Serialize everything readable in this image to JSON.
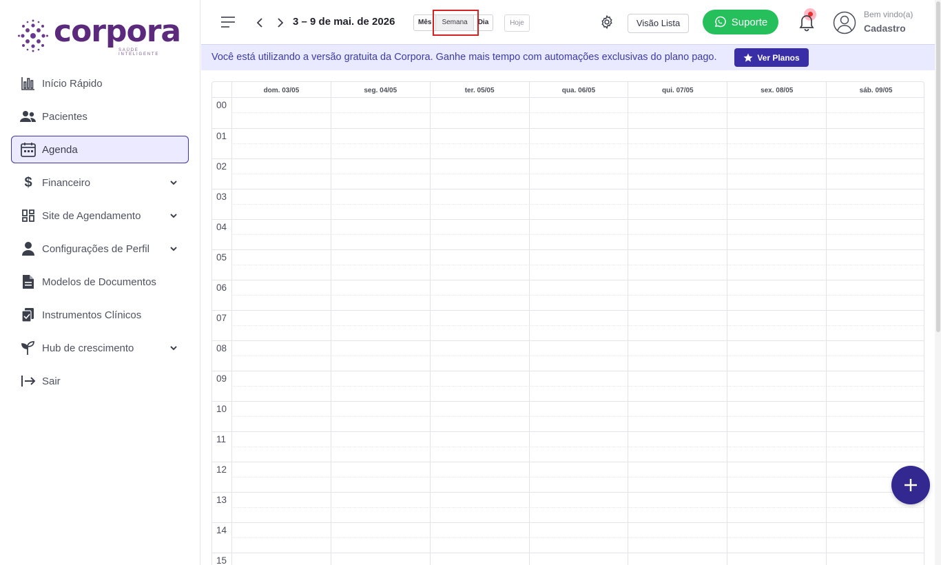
{
  "brand": {
    "name": "corpora",
    "tagline": "SAÚDE INTELIGENTE",
    "color": "#5b2a7d"
  },
  "sidebar": {
    "items": [
      {
        "label": "Início Rápido",
        "icon": "bar-chart-icon",
        "active": false,
        "expandable": false
      },
      {
        "label": "Pacientes",
        "icon": "users-icon",
        "active": false,
        "expandable": false
      },
      {
        "label": "Agenda",
        "icon": "calendar-icon",
        "active": true,
        "expandable": false
      },
      {
        "label": "Financeiro",
        "icon": "dollar-icon",
        "active": false,
        "expandable": true
      },
      {
        "label": "Site de Agendamento",
        "icon": "grid-icon",
        "active": false,
        "expandable": true
      },
      {
        "label": "Configurações de Perfil",
        "icon": "person-icon",
        "active": false,
        "expandable": true
      },
      {
        "label": "Modelos de Documentos",
        "icon": "document-icon",
        "active": false,
        "expandable": false
      },
      {
        "label": "Instrumentos Clínicos",
        "icon": "clipboard-icon",
        "active": false,
        "expandable": false
      },
      {
        "label": "Hub de crescimento",
        "icon": "sprout-icon",
        "active": false,
        "expandable": true
      },
      {
        "label": "Sair",
        "icon": "logout-icon",
        "active": false,
        "expandable": false
      }
    ]
  },
  "topbar": {
    "range_title": "3 – 9 de mai. de 2026",
    "views": {
      "month": "Mês",
      "week": "Semana",
      "day": "Dia"
    },
    "selected_view": "Semana",
    "today": "Hoje",
    "list_view": "Visão Lista",
    "support": "Suporte",
    "welcome": "Bem vindo(a)",
    "user_name": "Cadastro"
  },
  "banner": {
    "text": "Você está utilizando a versão gratuita da Corpora. Ganhe mais tempo com automações exclusivas do plano pago.",
    "button": "Ver Planos"
  },
  "calendar": {
    "days": [
      "dom. 03/05",
      "seg. 04/05",
      "ter. 05/05",
      "qua. 06/05",
      "qui. 07/05",
      "sex. 08/05",
      "sáb. 09/05"
    ],
    "hours": [
      "00",
      "01",
      "02",
      "03",
      "04",
      "05",
      "06",
      "07",
      "08",
      "09",
      "10",
      "11",
      "12",
      "13",
      "14",
      "15"
    ]
  },
  "colors": {
    "accent": "#3a2ea6",
    "support_green": "#25c05c",
    "active_bg": "#eceaff",
    "banner_bg": "#e9eaff",
    "highlight": "#d42020"
  }
}
